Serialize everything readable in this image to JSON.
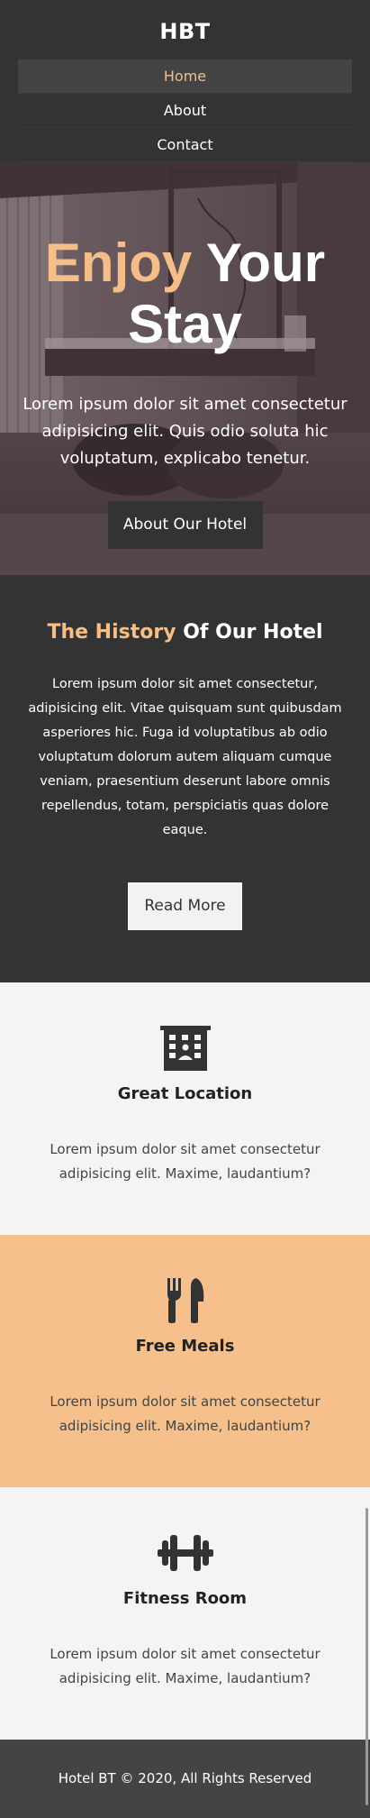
{
  "header": {
    "brand": "HBT",
    "nav": [
      {
        "label": "Home",
        "active": true
      },
      {
        "label": "About",
        "active": false
      },
      {
        "label": "Contact",
        "active": false
      }
    ]
  },
  "hero": {
    "title_accent": "Enjoy",
    "title_rest_line1": "Your",
    "title_line2": "Stay",
    "text": "Lorem ipsum dolor sit amet consectetur adipisicing elit. Quis odio soluta hic voluptatum, explicabo tenetur.",
    "button_label": "About Our Hotel"
  },
  "history": {
    "title_accent": "The History",
    "title_rest": "Of Our Hotel",
    "text": "Lorem ipsum dolor sit amet consectetur, adipisicing elit. Vitae quisquam sunt quibusdam asperiores hic. Fuga id voluptatibus ab odio voluptatum dolorum autem aliquam cumque veniam, praesentium deserunt labore omnis repellendus, totam, perspiciatis quas dolore eaque.",
    "button_label": "Read More"
  },
  "features": [
    {
      "icon": "hotel-icon",
      "title": "Great Location",
      "text": "Lorem ipsum dolor sit amet consectetur adipisicing elit. Maxime, laudantium?"
    },
    {
      "icon": "utensils-icon",
      "title": "Free Meals",
      "text": "Lorem ipsum dolor sit amet consectetur adipisicing elit. Maxime, laudantium?"
    },
    {
      "icon": "dumbbell-icon",
      "title": "Fitness Room",
      "text": "Lorem ipsum dolor sit amet consectetur adipisicing elit. Maxime, laudantium?"
    }
  ],
  "footer": {
    "text": "Hotel BT © 2020, All Rights Reserved"
  },
  "colors": {
    "dark": "#333333",
    "accent": "#f5bd87",
    "light": "#f4f4f4",
    "footer": "#444444"
  }
}
